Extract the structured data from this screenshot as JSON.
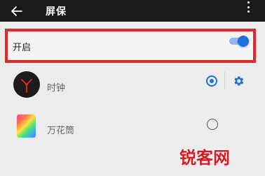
{
  "header": {
    "title": "屏保"
  },
  "screensaver_toggle": {
    "label": "开启",
    "enabled": true
  },
  "options": [
    {
      "label": "时钟",
      "icon": "clock-icon",
      "selected": true,
      "has_settings": true
    },
    {
      "label": "万花筒",
      "icon": "kaleidoscope-icon",
      "selected": false,
      "has_settings": false
    }
  ],
  "watermark": {
    "text": "锐客网"
  },
  "colors": {
    "accent": "#1e6fe0",
    "highlight": "#e8252a",
    "appbar": "#1a1a1a",
    "watermark": "#e0161e"
  }
}
